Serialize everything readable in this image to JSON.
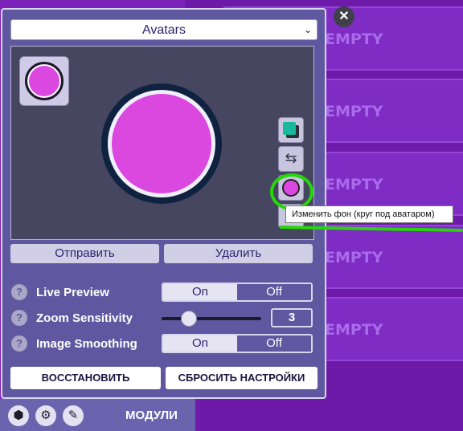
{
  "background_slots": {
    "label": "EMPTY",
    "count": 5
  },
  "dialog": {
    "close_label": "✕",
    "avatar_select": "Avatars",
    "send_button": "Отправить",
    "delete_button": "Удалить",
    "tooltip": "Изменить фон (круг под аватаром)",
    "colors": {
      "avatar_fill": "#da48e0",
      "viewport_bg": "#474661",
      "color_swatch": "#17b89c",
      "highlight": "#27d60a"
    },
    "settings": {
      "live_preview": {
        "label": "Live Preview",
        "on": "On",
        "off": "Off",
        "selected": "On"
      },
      "zoom_sensitivity": {
        "label": "Zoom Sensitivity",
        "value": "3",
        "slider_fraction": 0.27
      },
      "image_smoothing": {
        "label": "Image Smoothing",
        "on": "On",
        "off": "Off",
        "selected": "On"
      },
      "help_glyph": "?"
    },
    "restore_button": "ВОССТАНОВИТЬ",
    "reset_button": "СБРОСИТЬ НАСТРОЙКИ"
  },
  "footer": {
    "icons": [
      "cube-icon",
      "gear-icon",
      "wrench-icon"
    ],
    "label": "МОДУЛИ"
  }
}
